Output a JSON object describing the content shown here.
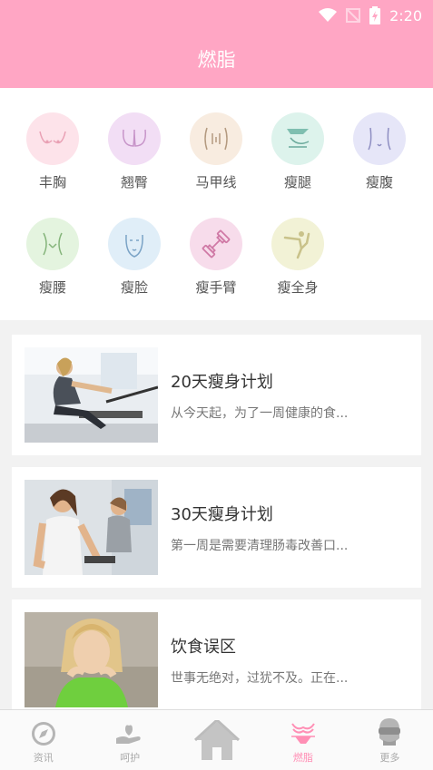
{
  "status_bar": {
    "time": "2:20"
  },
  "header": {
    "title": "燃脂"
  },
  "categories": [
    {
      "label": "丰胸",
      "icon": "chest-icon",
      "color": "#fde3ea"
    },
    {
      "label": "翘臀",
      "icon": "buttocks-icon",
      "color": "#f2def5"
    },
    {
      "label": "马甲线",
      "icon": "abs-icon",
      "color": "#f8ece0"
    },
    {
      "label": "瘦腿",
      "icon": "leg-icon",
      "color": "#ddf3ec"
    },
    {
      "label": "瘦腹",
      "icon": "belly-icon",
      "color": "#e6e6f8"
    },
    {
      "label": "瘦腰",
      "icon": "waist-icon",
      "color": "#e4f4df"
    },
    {
      "label": "瘦脸",
      "icon": "face-icon",
      "color": "#e0eef8"
    },
    {
      "label": "瘦手臂",
      "icon": "dumbbell-icon",
      "color": "#f7dceb"
    },
    {
      "label": "瘦全身",
      "icon": "yoga-pose-icon",
      "color": "#f2f2d6"
    }
  ],
  "articles": [
    {
      "title": "20天瘦身计划",
      "desc": "从今天起，为了一周健康的食..."
    },
    {
      "title": "30天瘦身计划",
      "desc": "第一周是需要清理肠毒改善口..."
    },
    {
      "title": "饮食误区",
      "desc": "世事无绝对，过犹不及。正在..."
    }
  ],
  "tabs": [
    {
      "label": "资讯",
      "icon": "compass-icon"
    },
    {
      "label": "呵护",
      "icon": "care-hand-icon"
    },
    {
      "label": "",
      "icon": "home-icon"
    },
    {
      "label": "燃脂",
      "icon": "bikini-icon"
    },
    {
      "label": "更多",
      "icon": "glasses-avatar-icon"
    }
  ]
}
